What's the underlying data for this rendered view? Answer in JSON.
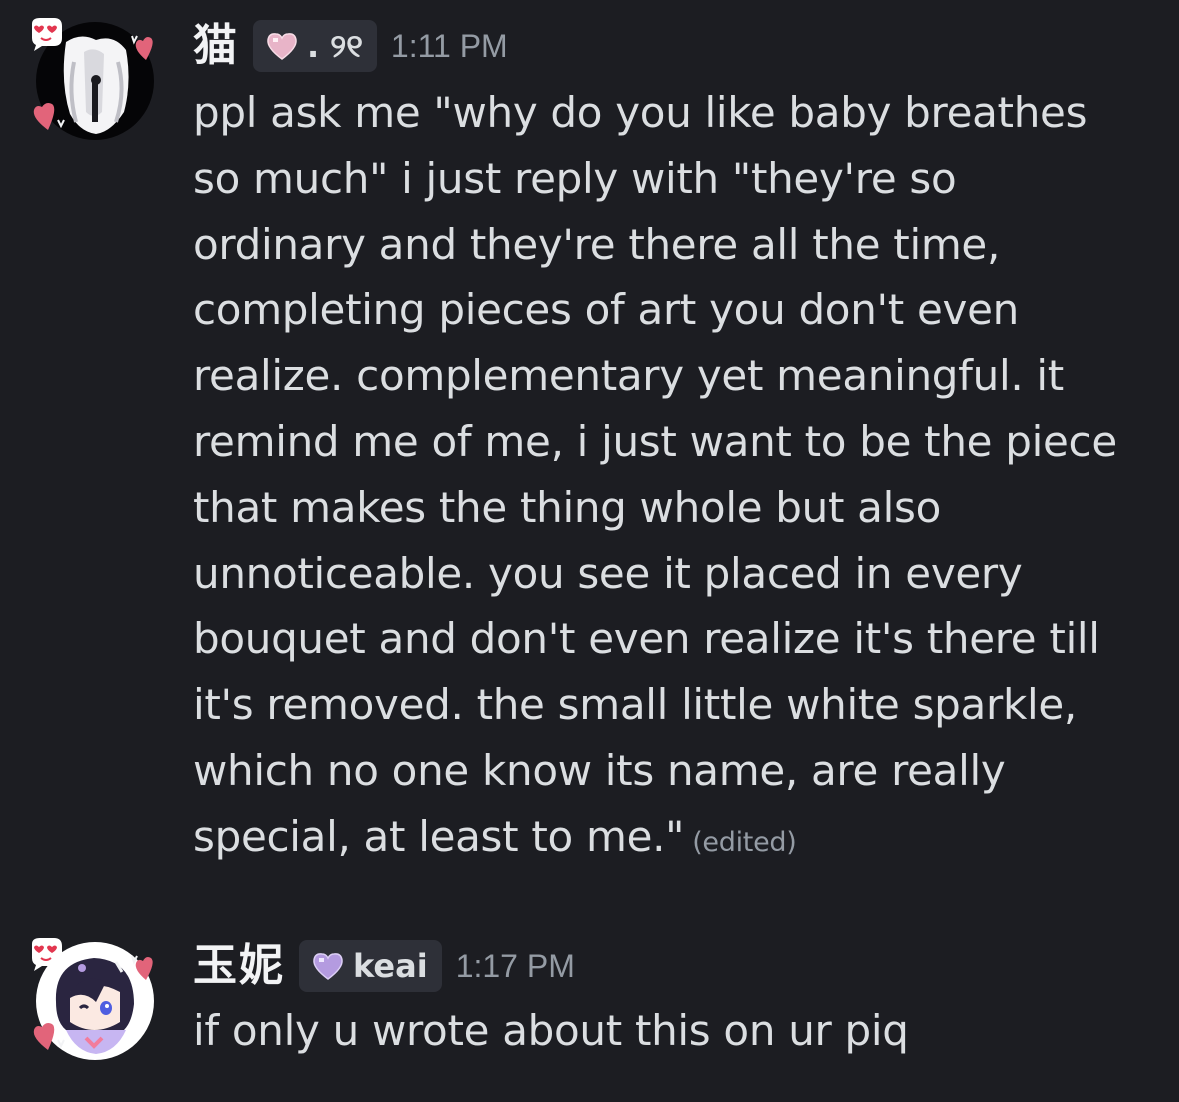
{
  "messages": [
    {
      "username": "猫",
      "tag": {
        "text": ". ୨୧",
        "heart_color": "#e8b4c8"
      },
      "timestamp": "1:11 PM",
      "lines": [
        "ppl ask me \"why do you like baby breathes",
        "so much\" i just reply with \"they're so",
        "ordinary and they're there all the time,",
        "completing pieces of art you don't even",
        "realize. complementary yet meaningful. it",
        "remind me of me, i just want to be the piece",
        "that makes the thing whole but also",
        "unnoticeable. you see it placed in every",
        "bouquet and don't even realize it's there till",
        "it's removed. the small little white sparkle,",
        "which no one know its name, are really",
        "special, at least to me.\""
      ],
      "edited_label": "(edited)"
    },
    {
      "username": "玉妮",
      "tag": {
        "text": "keai",
        "heart_color": "#b49be0"
      },
      "timestamp": "1:17 PM",
      "lines": [
        "if only u wrote about this on ur piq"
      ]
    }
  ],
  "colors": {
    "background": "#1c1d22",
    "text": "#dbdee1",
    "muted": "#949ba4",
    "tag_bg": "#2e3038",
    "heart_pink": "#e2647a"
  }
}
